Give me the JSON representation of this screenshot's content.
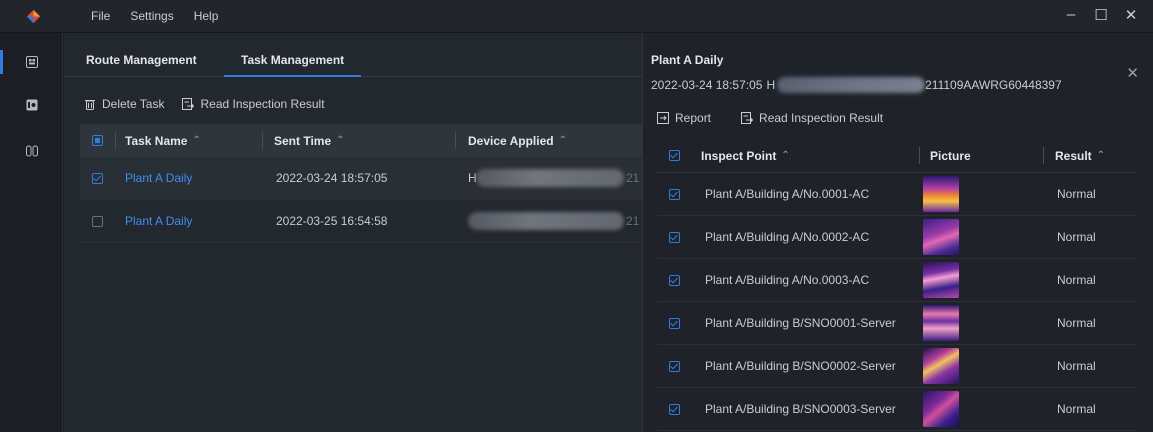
{
  "menu": [
    "File",
    "Settings",
    "Help"
  ],
  "window_controls": {
    "minimize": "–",
    "maximize": "☐",
    "close": "✕"
  },
  "rail": [
    {
      "icon": "app-grid-icon",
      "active": true
    },
    {
      "icon": "device-icon",
      "active": false
    },
    {
      "icon": "inspection-icon",
      "active": false
    }
  ],
  "tabs": {
    "route": "Route Management",
    "task": "Task Management"
  },
  "toolbar": {
    "delete": "Delete Task",
    "read": "Read Inspection Result"
  },
  "grid": {
    "headers": {
      "name": "Task Name",
      "sent": "Sent Time",
      "device": "Device Applied"
    },
    "sort_glyph": "⌃",
    "rows": [
      {
        "name": "Plant A Daily",
        "sent": "2022-03-24 18:57:05",
        "device_visible_start": "H",
        "device_visible_end": "21",
        "checked": true
      },
      {
        "name": "Plant A Daily",
        "sent": "2022-03-25 16:54:58",
        "device_visible_start": "",
        "device_visible_end": "21",
        "checked": false
      }
    ]
  },
  "panel": {
    "title": "Plant A Daily",
    "timestamp": "2022-03-24 18:57:05",
    "id_start": "H",
    "id_end": "211109AAWRG60448397",
    "close": "✕",
    "tools": {
      "report": "Report",
      "read": "Read Inspection Result"
    },
    "headers": {
      "point": "Inspect Point",
      "picture": "Picture",
      "result": "Result"
    },
    "rows": [
      {
        "point": "Plant A/Building A/No.0001-AC",
        "result": "Normal"
      },
      {
        "point": "Plant A/Building A/No.0002-AC",
        "result": "Normal"
      },
      {
        "point": "Plant A/Building A/No.0003-AC",
        "result": "Normal"
      },
      {
        "point": "Plant A/Building B/SNO0001-Server",
        "result": "Normal"
      },
      {
        "point": "Plant A/Building B/SNO0002-Server",
        "result": "Normal"
      },
      {
        "point": "Plant A/Building B/SNO0003-Server",
        "result": "Normal"
      }
    ]
  },
  "colors": {
    "accent": "#2f7de1",
    "link": "#3d8fef",
    "bg": "#1b1e23"
  }
}
